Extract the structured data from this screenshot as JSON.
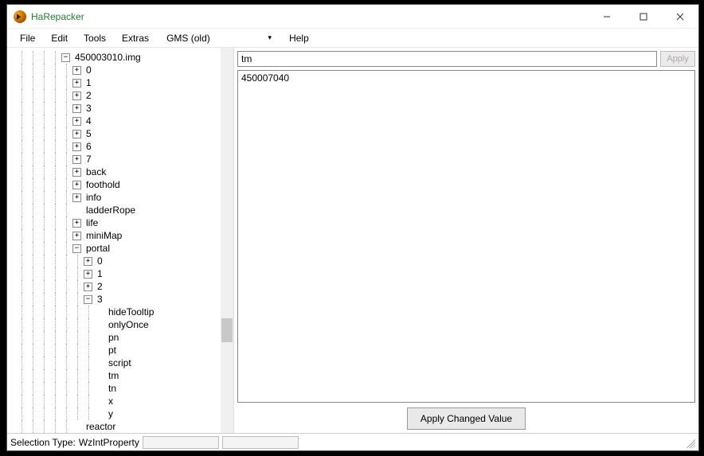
{
  "app": {
    "title": "HaRepacker"
  },
  "menu": {
    "file": "File",
    "edit": "Edit",
    "tools": "Tools",
    "extras": "Extras",
    "version": "GMS (old)",
    "help": "Help"
  },
  "tree": {
    "root": "450003010.img",
    "nums": [
      "0",
      "1",
      "2",
      "3",
      "4",
      "5",
      "6",
      "7"
    ],
    "back": "back",
    "foothold": "foothold",
    "info": "info",
    "ladderRope": "ladderRope",
    "life": "life",
    "miniMap": "miniMap",
    "portal": "portal",
    "portal_children": [
      "0",
      "1",
      "2",
      "3"
    ],
    "portal3_children": [
      "hideTooltip",
      "onlyOnce",
      "pn",
      "pt",
      "script",
      "tm",
      "tn",
      "x",
      "y"
    ],
    "reactor": "reactor"
  },
  "editor": {
    "name": "tm",
    "value": "450007040",
    "apply_small": "Apply",
    "apply_changed": "Apply Changed Value"
  },
  "status": {
    "selection_label": "Selection Type:",
    "selection_value": "WzIntProperty"
  }
}
